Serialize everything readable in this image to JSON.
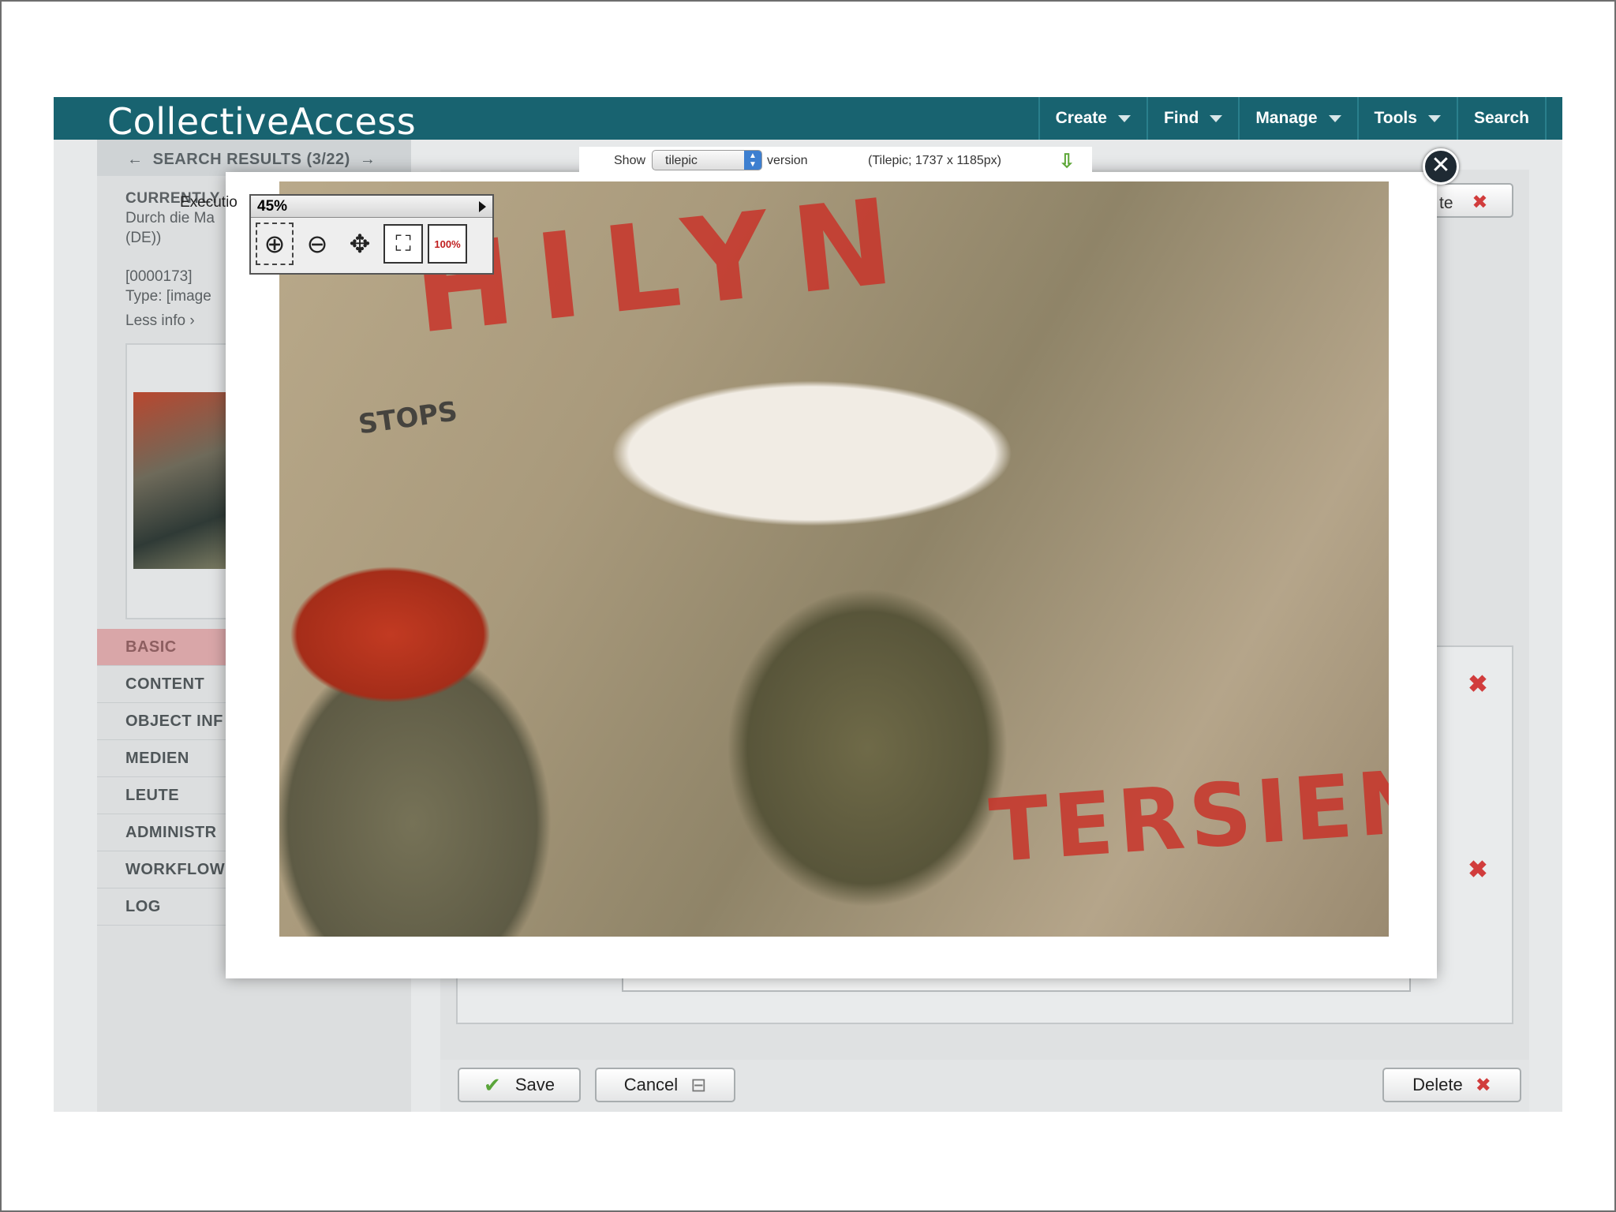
{
  "app": {
    "logo": "CollectiveAccess",
    "nav": [
      {
        "label": "Create",
        "dropdown": true
      },
      {
        "label": "Find",
        "dropdown": true
      },
      {
        "label": "Manage",
        "dropdown": true
      },
      {
        "label": "Tools",
        "dropdown": true
      },
      {
        "label": "Search",
        "dropdown": false
      }
    ]
  },
  "sidebar": {
    "breadcrumb": {
      "back": "←",
      "label": "SEARCH RESULTS (3/22)",
      "next": "→"
    },
    "info": {
      "heading": "CURRENTLY",
      "title_line1": "Durch die Ma",
      "title_line2": "(DE))",
      "id": "[0000173]",
      "type": "Type: [image",
      "less_info": "Less info ›"
    },
    "peek_label": "Executio",
    "nav": [
      {
        "label": "BASIC",
        "active": true
      },
      {
        "label": "CONTENT",
        "active": false
      },
      {
        "label": "OBJECT INF",
        "active": false
      },
      {
        "label": "MEDIEN",
        "active": false
      },
      {
        "label": "LEUTE",
        "active": false
      },
      {
        "label": "ADMINISTR",
        "active": false
      },
      {
        "label": "WORKFLOW",
        "active": false
      },
      {
        "label": "LOG",
        "active": false
      }
    ]
  },
  "form": {
    "delete_peek": "te",
    "buttons": {
      "save": "Save",
      "cancel": "Cancel",
      "delete": "Delete"
    }
  },
  "viewer": {
    "show_label": "Show",
    "version_select": "tilepic",
    "version_label": "version",
    "media_info": "(Tilepic; 1737 x 1185px)",
    "zoom_level": "45%",
    "hundred_label": "100%",
    "graffiti": {
      "top": "HILYN",
      "stops": "STOPS",
      "bottom": "TERSIEN"
    },
    "icons": {
      "zoom_in": "zoom-in-icon",
      "zoom_out": "zoom-out-icon",
      "pan": "pan-icon",
      "fit": "fit-to-window-icon",
      "download": "download-icon",
      "close": "close-icon"
    }
  },
  "colors": {
    "topbar": "#186370",
    "active_nav": "#d9a6a8",
    "delete_red": "#d13c3c"
  }
}
